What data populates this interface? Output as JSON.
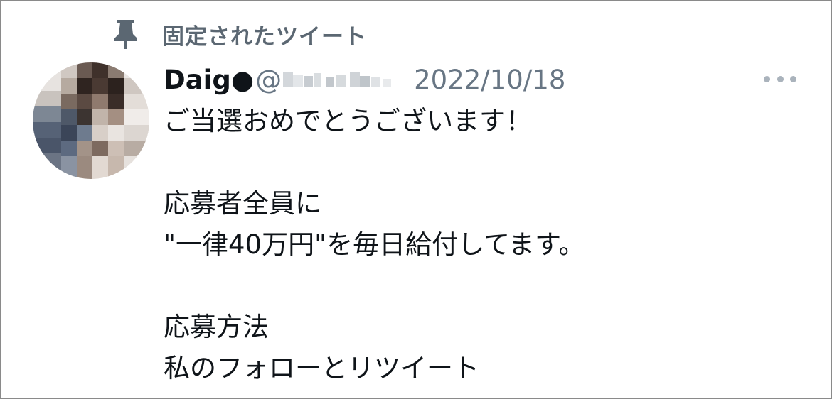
{
  "pinned_label": "固定されたツイート",
  "tweet": {
    "display_name": "Daig●",
    "handle_prefix": "@",
    "date": "2022/10/18",
    "lines": [
      "ご当選おめでとうございます！",
      "",
      "応募者全員に",
      "\"一律40万円\"を毎日給付してます。",
      "",
      "応募方法",
      "私のフォローとリツイート"
    ]
  },
  "icons": {
    "pin": "pin-icon",
    "more": "more-options-icon",
    "avatar": "user-avatar (pixelated)"
  },
  "colors": {
    "text_primary": "#0f1419",
    "text_secondary": "#687684",
    "pin_label": "#5b6772",
    "border": "#8a8a8a"
  }
}
